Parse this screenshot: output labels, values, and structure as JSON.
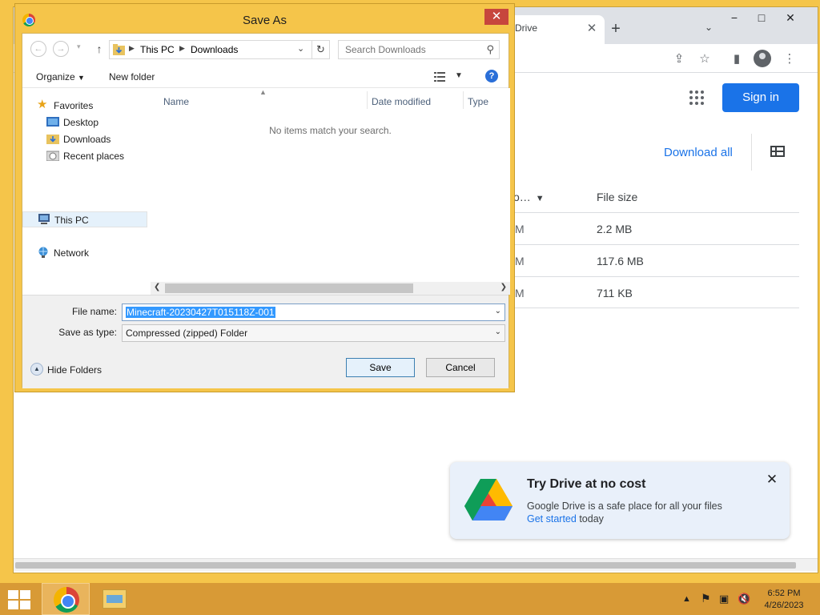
{
  "browser": {
    "tab": {
      "title": "Drive"
    },
    "window_controls": {
      "minimize": "−",
      "maximize": "□",
      "close": "✕"
    },
    "sign_in": "Sign in",
    "download_all": "Download all",
    "columns": {
      "name_fragment": "o…",
      "file_size": "File size"
    },
    "rows": [
      {
        "time_fragment": "M",
        "size": "2.2 MB"
      },
      {
        "time_fragment": "M",
        "size": "117.6 MB"
      },
      {
        "time_fragment": "M",
        "size": "711 KB"
      }
    ],
    "promo": {
      "title": "Try Drive at no cost",
      "body": "Google Drive is a safe place for all your files",
      "link": "Get started",
      "tail": " today"
    }
  },
  "dialog": {
    "title": "Save As",
    "breadcrumb": [
      "This PC",
      "Downloads"
    ],
    "search": {
      "placeholder": "Search Downloads"
    },
    "toolbar": {
      "organize": "Organize",
      "new_folder": "New folder"
    },
    "nav": {
      "favorites": "Favorites",
      "desktop": "Desktop",
      "downloads": "Downloads",
      "recent": "Recent places",
      "this_pc": "This PC",
      "network": "Network"
    },
    "columns": {
      "name": "Name",
      "date_modified": "Date modified",
      "type": "Type"
    },
    "empty_message": "No items match your search.",
    "file_name_label": "File name:",
    "file_name_value": "Minecraft-20230427T015118Z-001",
    "save_type_label": "Save as type:",
    "save_type_value": "Compressed (zipped) Folder",
    "hide_folders": "Hide Folders",
    "save_button": "Save",
    "cancel_button": "Cancel"
  },
  "taskbar": {
    "time": "6:52 PM",
    "date": "4/26/2023"
  },
  "colors": {
    "window_frame": "#f5c54a",
    "taskbar": "#d89a36",
    "accent_blue": "#1a73e8",
    "selection": "#3399ff"
  }
}
